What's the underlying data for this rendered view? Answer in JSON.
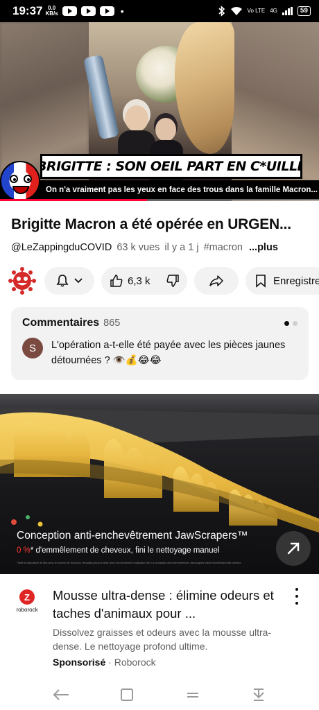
{
  "status_bar": {
    "time": "19:37",
    "net_speed": "0.0",
    "net_unit": "KB/s",
    "dot": "•",
    "carrier_small": "Vo LTE",
    "network": "4G",
    "battery": "59"
  },
  "video": {
    "banner": "BRIGITTE : SON OEIL PART EN C*UILLE",
    "subtitle": "On n'a vraiment pas les yeux en face des trous dans la famille Macron...",
    "progress_fraction": 0.46
  },
  "details": {
    "title": "Brigitte Macron a été opérée en URGEN...",
    "channel": "@LeZappingduCOVID",
    "views": "63 k vues",
    "age": "il y a 1 j",
    "hashtag": "#macron",
    "more": "...plus"
  },
  "actions": {
    "likes": "6,3 k",
    "save_label": "Enregistrer"
  },
  "comments": {
    "title": "Commentaires",
    "count": "865",
    "avatar_letter": "S",
    "top_comment": "L'opération a-t-elle été payée avec les pièces jaunes détournées ? 👁️💰😂😂"
  },
  "ad": {
    "media_title": "Conception anti-enchevêtrement JawScrapers™",
    "media_pct": "0 %",
    "media_sub": "* d'emmêlement de cheveux, fini le nettoyage manuel",
    "fine_print": "*Testé en laboratoire de tiers selon les normes de Roborock. Résultats peuvent varier selon l'environnement d'utilisation réel. La conception anti-enchevêtrement JawScrapers réduit l'emmêlement des cheveux.",
    "logo_mark": "Z",
    "logo_word": "roborock",
    "title": "Mousse ultra-dense : élimine odeurs et taches d'animaux pour ...",
    "description": "Dissolvez graisses et odeurs avec la mousse ultra-dense. Le nettoyage profond ultime.",
    "sponsored_label": "Sponsorisé",
    "separator": " · ",
    "advertiser": "Roborock"
  },
  "colors": {
    "accent_red": "#ff0033",
    "chip_bg": "#f2f2f2",
    "secondary_text": "#606060"
  },
  "icons": [
    "youtube-icon",
    "bluetooth-icon",
    "wifi-icon",
    "bell-icon",
    "chevron-down-icon",
    "thumb-up-icon",
    "thumb-down-icon",
    "share-icon",
    "bookmark-icon",
    "open-external-icon",
    "more-vert-icon",
    "back-icon",
    "home-icon",
    "recents-icon",
    "hide-nav-icon"
  ]
}
